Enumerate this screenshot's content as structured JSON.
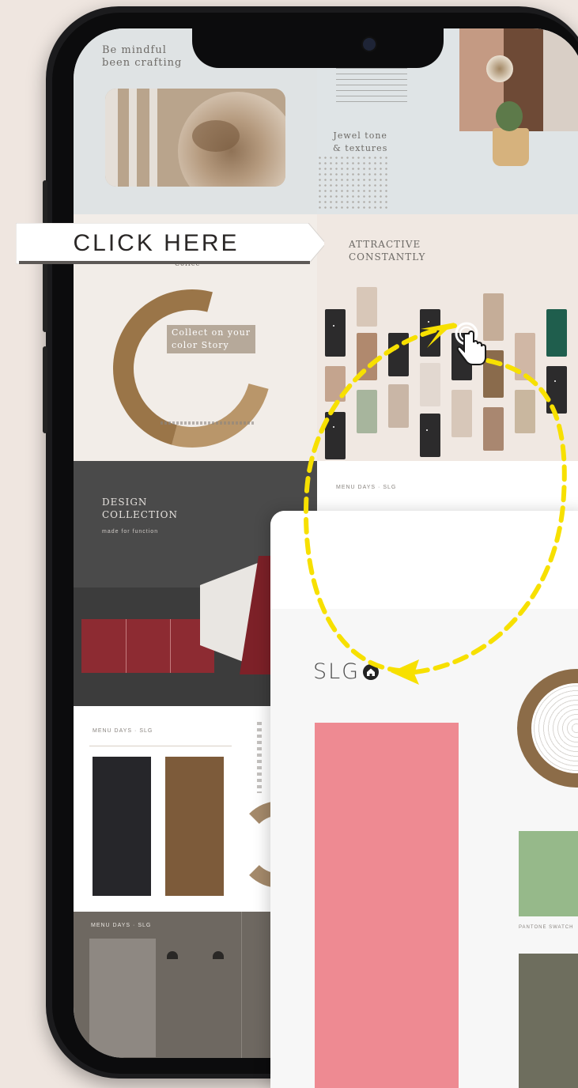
{
  "callout": {
    "click_label": "CLICK HERE"
  },
  "tiles": {
    "pottery_heading": "Be mindful\nbeen crafting",
    "pottery_caption": "Jewel tone\n& textures",
    "circle_caption_top": "Coffee",
    "circle_caption": "Collect on your\ncolor Story",
    "grid_heading": "ATTRACTIVE\nCONSTANTLY",
    "kitchen_heading": "DESIGN\nCOLLECTION",
    "kitchen_sub": "made for function",
    "nav_label": "MENU  DAYS  ·  SLG",
    "nav_label_2": "MENU  DAYS  ·  SLG",
    "nav_label_3": "MENU  DAYS  ·  SLG"
  },
  "zoom": {
    "logo_text": "SLG",
    "swatch_caption": "PANTONE SWATCH"
  },
  "colors": {
    "accent_yellow": "#f7e000",
    "pink_swatch": "#ee8a92",
    "green_swatch": "#96b98a",
    "olive_swatch": "#6e6e5e",
    "kitchen_red": "#8d2b32",
    "dark_wall": "#4a4a4a"
  },
  "icons": {
    "home": "home-icon",
    "pointer": "hand-pointer-icon",
    "arrow": "dashed-arrow-icon"
  }
}
